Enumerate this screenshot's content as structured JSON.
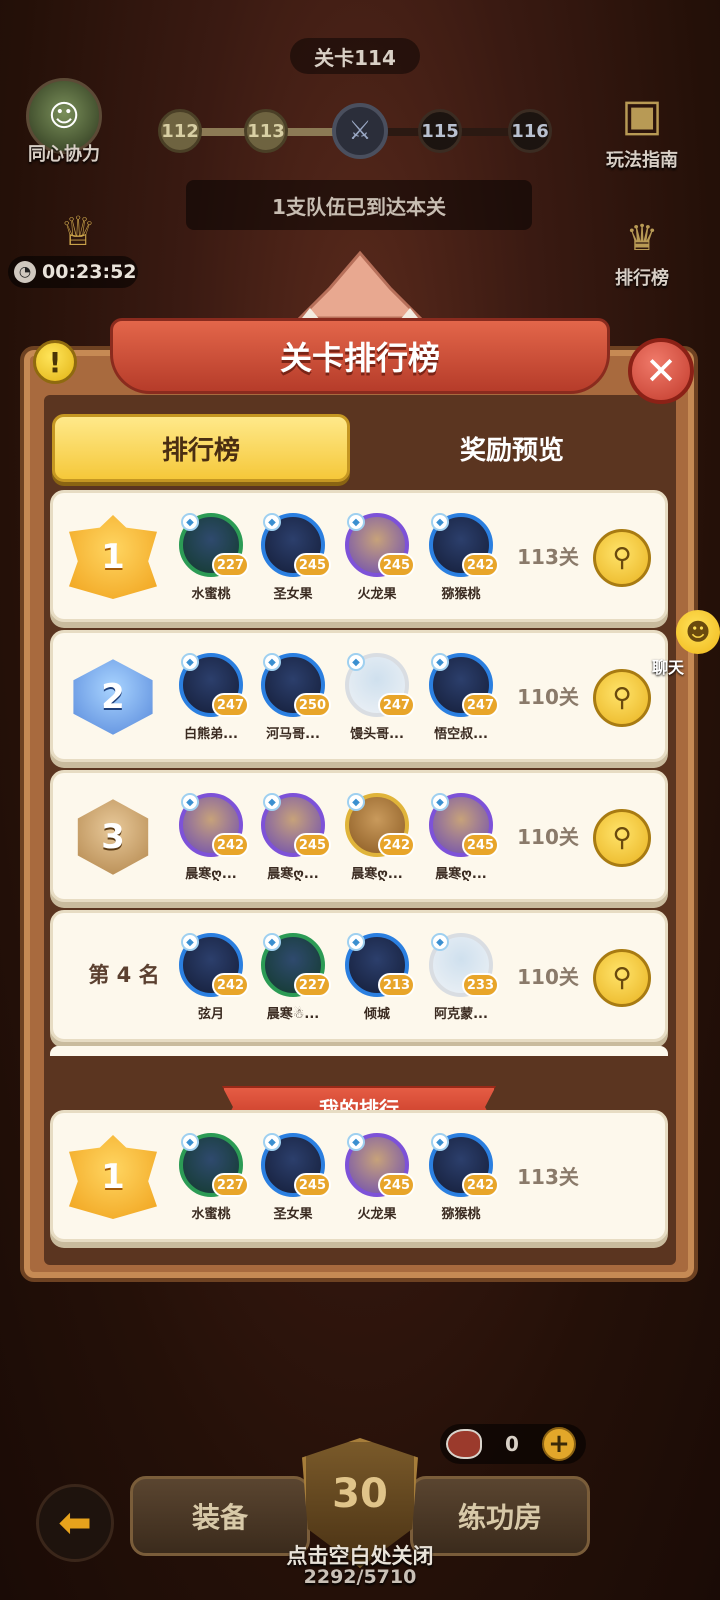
{
  "header": {
    "level_title": "关卡114",
    "progress_nodes": [
      "112",
      "113",
      "⚔",
      "115",
      "116"
    ],
    "teams_status": "1支队伍已到达本关"
  },
  "side": {
    "coop_label": "同心协力",
    "guide_label": "玩法指南",
    "rank_label": "排行榜",
    "timer": "00:23:52"
  },
  "modal": {
    "title": "关卡排行榜",
    "warn_symbol": "!",
    "close_symbol": "✕",
    "tabs": [
      {
        "label": "排行榜",
        "active": true
      },
      {
        "label": "奖励预览",
        "active": false
      }
    ],
    "rows": [
      {
        "rank": "1",
        "badge": "gold",
        "stage": "113关",
        "members": [
          {
            "name": "水蜜桃",
            "level": "227",
            "style": "green"
          },
          {
            "name": "圣女果",
            "level": "245",
            "style": "blue"
          },
          {
            "name": "火龙果",
            "level": "245",
            "style": "purple"
          },
          {
            "name": "猕猴桃",
            "level": "242",
            "style": "blue"
          }
        ]
      },
      {
        "rank": "2",
        "badge": "silver",
        "stage": "110关",
        "members": [
          {
            "name": "白熊弟...",
            "level": "247",
            "style": "blue"
          },
          {
            "name": "河马哥...",
            "level": "250",
            "style": "blue"
          },
          {
            "name": "馒头哥...",
            "level": "247",
            "style": "white"
          },
          {
            "name": "悟空叔...",
            "level": "247",
            "style": "blue"
          }
        ]
      },
      {
        "rank": "3",
        "badge": "bronze",
        "stage": "110关",
        "members": [
          {
            "name": "晨寒ღ...",
            "level": "242",
            "style": "purple"
          },
          {
            "name": "晨寒ღ...",
            "level": "245",
            "style": "purple"
          },
          {
            "name": "晨寒ღ...",
            "level": "242",
            "style": "gold"
          },
          {
            "name": "晨寒ღ...",
            "level": "245",
            "style": "purple"
          }
        ]
      },
      {
        "rank": "第 4 名",
        "badge": "text",
        "stage": "110关",
        "members": [
          {
            "name": "弦月",
            "level": "242",
            "style": "blue"
          },
          {
            "name": "晨寒☃...",
            "level": "227",
            "style": "green"
          },
          {
            "name": "倾城",
            "level": "213",
            "style": "blue"
          },
          {
            "name": "阿克蒙...",
            "level": "233",
            "style": "white"
          }
        ]
      }
    ],
    "my_rank_label": "我的排行",
    "my_row": {
      "rank": "1",
      "badge": "gold",
      "stage": "113关",
      "members": [
        {
          "name": "水蜜桃",
          "level": "227",
          "style": "green"
        },
        {
          "name": "圣女果",
          "level": "245",
          "style": "blue"
        },
        {
          "name": "火龙果",
          "level": "245",
          "style": "purple"
        },
        {
          "name": "猕猴桃",
          "level": "242",
          "style": "blue"
        }
      ]
    }
  },
  "chat": {
    "label": "聊天"
  },
  "bottom": {
    "equip_label": "装备",
    "train_label": "练功房",
    "shield_level": "30",
    "meat_count": "0",
    "plus_symbol": "+",
    "close_hint": "点击空白处关闭",
    "exp": "2292/5710",
    "back_symbol": "⬅"
  },
  "icons": {
    "coop": "coop-avatar-icon",
    "guide": "treasure-chest-icon",
    "rank": "podium-icon",
    "search": "search-icon",
    "clock": "clock-icon",
    "meat": "meat-icon"
  },
  "colors": {
    "accent_gold": "#f5c83a",
    "banner_red": "#c63a26",
    "row_bg": "#fdf8ec",
    "frame_wood": "#a86a3e"
  }
}
